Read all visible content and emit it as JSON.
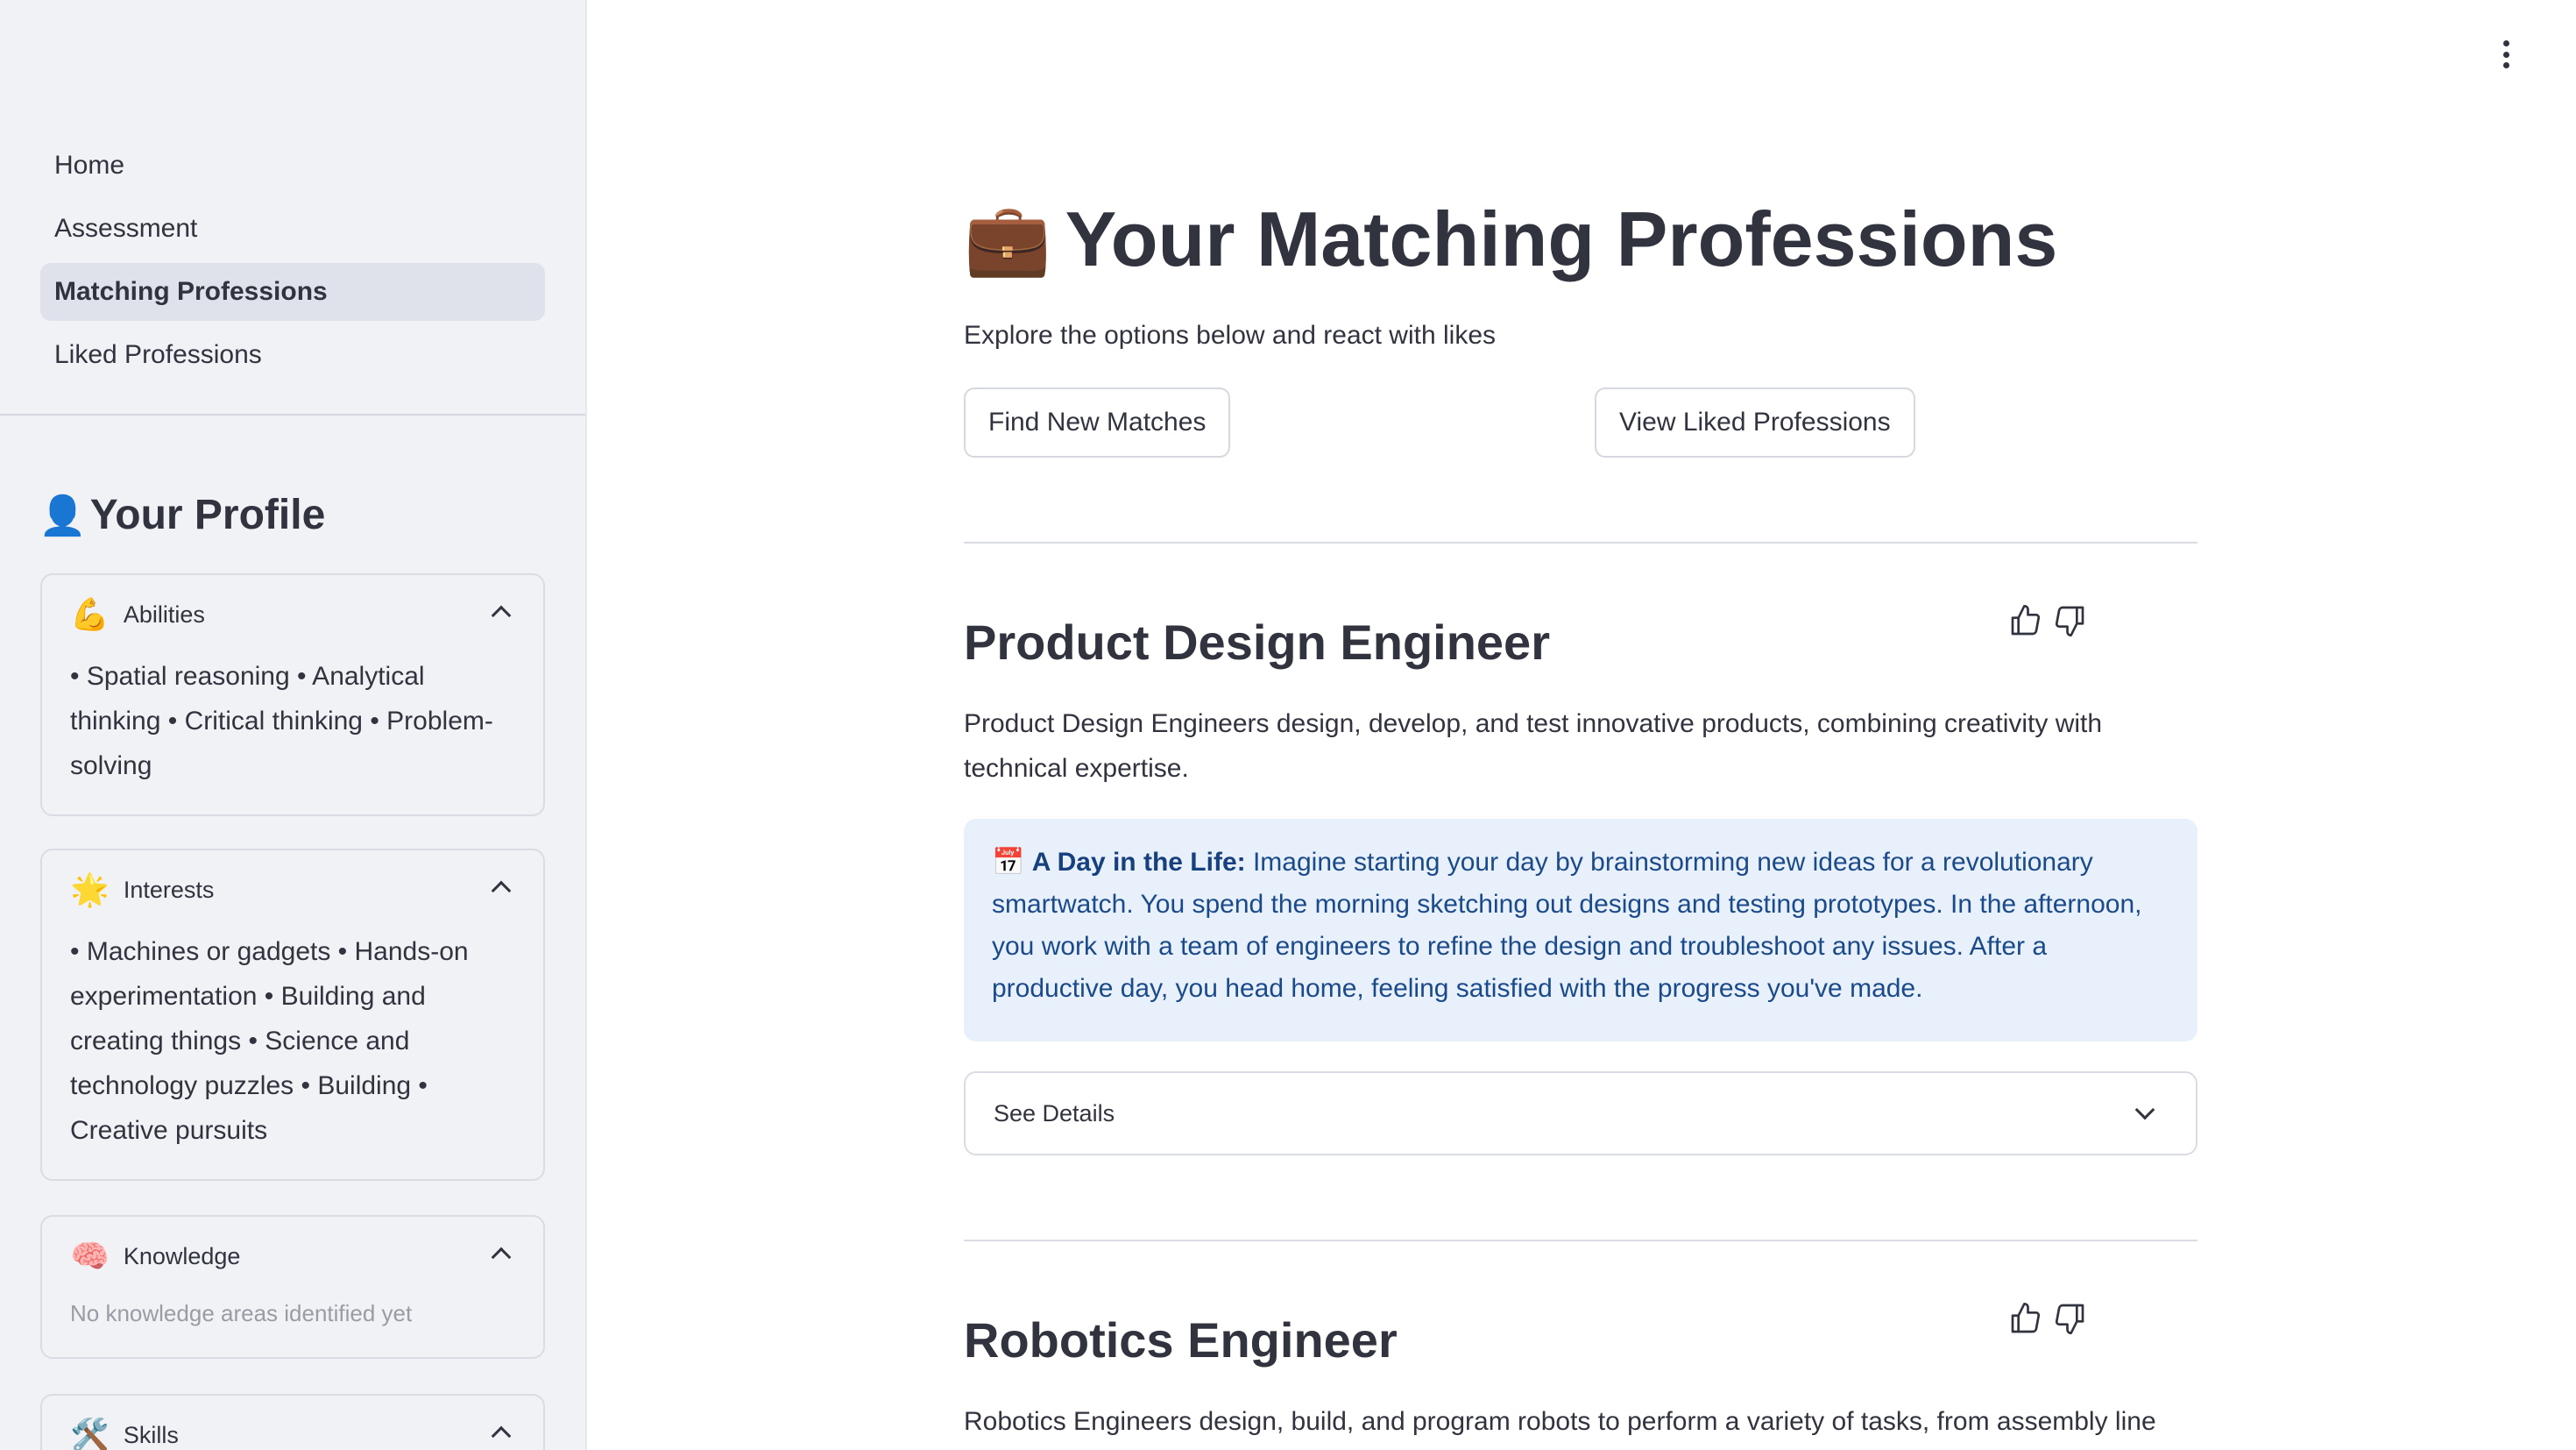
{
  "sidebar": {
    "nav": [
      {
        "label": "Home"
      },
      {
        "label": "Assessment"
      },
      {
        "label": "Matching Professions",
        "active": true
      },
      {
        "label": "Liked Professions"
      }
    ],
    "profile_title": "Your Profile",
    "profile_icon": "👤",
    "sections": [
      {
        "icon": "💪",
        "label": "Abilities",
        "content": "• Spatial reasoning • Analytical thinking • Critical thinking • Problem-solving"
      },
      {
        "icon": "🌟",
        "label": "Interests",
        "content": "• Machines or gadgets • Hands-on experimentation • Building and creating things • Science and technology puzzles • Building • Creative pursuits"
      },
      {
        "icon": "🧠",
        "label": "Knowledge",
        "content": "No knowledge areas identified yet"
      },
      {
        "icon": "🛠️",
        "label": "Skills",
        "content": ""
      }
    ]
  },
  "main": {
    "title_icon": "💼",
    "title": "Your Matching Professions",
    "subtitle": "Explore the options below and react with likes",
    "buttons": {
      "find": "Find New Matches",
      "view_liked": "View Liked Professions"
    },
    "professions": [
      {
        "title": "Product Design Engineer",
        "description": "Product Design Engineers design, develop, and test innovative products, combining creativity with technical expertise.",
        "day_icon": "📅",
        "day_label": "A Day in the Life:",
        "day_text": "Imagine starting your day by brainstorming new ideas for a revolutionary smartwatch. You spend the morning sketching out designs and testing prototypes. In the afternoon, you work with a team of engineers to refine the design and troubleshoot any issues. After a productive day, you head home, feeling satisfied with the progress you've made.",
        "details_label": "See Details"
      },
      {
        "title": "Robotics Engineer",
        "description": "Robotics Engineers design, build, and program robots to perform a variety of tasks, from assembly line"
      }
    ]
  }
}
